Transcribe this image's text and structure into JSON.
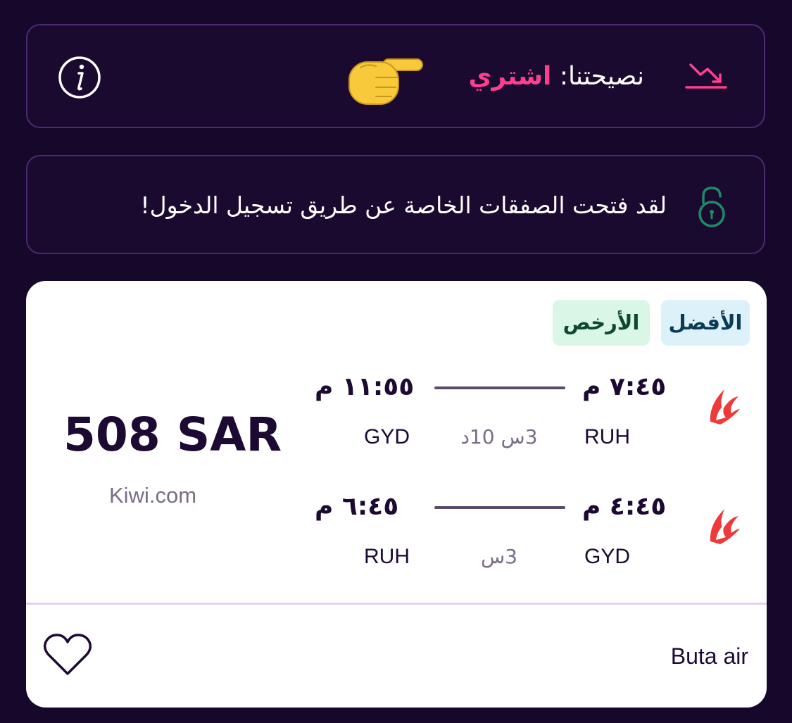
{
  "advice": {
    "label": "نصيحتنا:",
    "value": "اشتري",
    "icons": [
      "trend-down-icon",
      "pointing-hand-icon",
      "info-icon"
    ]
  },
  "deals": {
    "message": "لقد فتحت الصفقات الخاصة عن طريق تسجيل الدخول!",
    "icon": "unlock-icon"
  },
  "card": {
    "badges": {
      "best": "الأفضل",
      "cheapest": "الأرخص"
    },
    "outbound": {
      "departure_time": "٧:٤٥ م",
      "arrival_time": "١١:٥٥ م",
      "origin": "RUH",
      "destination": "GYD",
      "duration": "3س 10د"
    },
    "inbound": {
      "departure_time": "٤:٤٥ م",
      "arrival_time": "٦:٤٥ م",
      "origin": "GYD",
      "destination": "RUH",
      "duration": "3س"
    },
    "price": "508 SAR",
    "provider": "Kiwi.com",
    "airline": "Buta air"
  },
  "colors": {
    "background": "#16082a",
    "accent_pink": "#ff3f8e",
    "card_text": "#1c0a33",
    "muted": "#7a6d86",
    "badge_best_bg": "#dcf1fa",
    "badge_cheapest_bg": "#d9f6e6",
    "unlock_green": "#1e8a64"
  }
}
